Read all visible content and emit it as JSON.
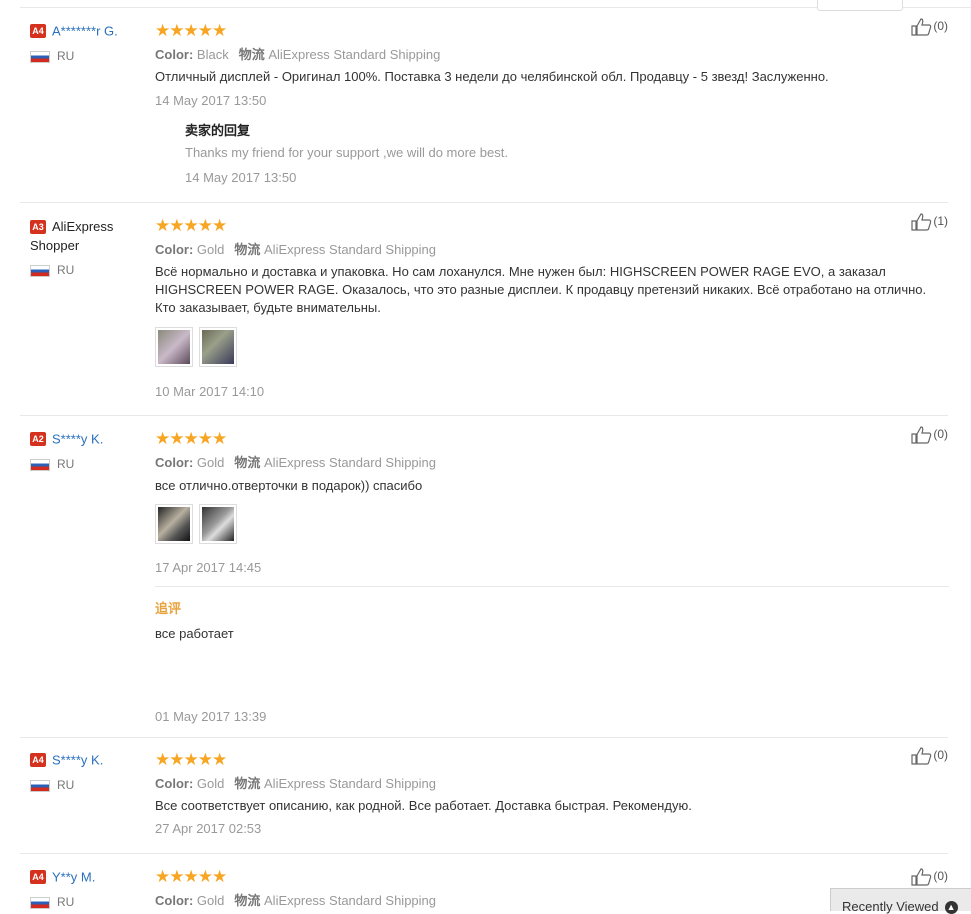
{
  "reviews": [
    {
      "level": "A4",
      "name": "A*******r G.",
      "country": "RU",
      "stars": "★★★★★",
      "color_label": "Color:",
      "color": "Black",
      "ship_label": "物流",
      "shipping": "AliExpress Standard Shipping",
      "text": "Отличный дисплей - Оригинал 100%. Поставка 3 недели до челябинской обл. Продавцу - 5 звезд! Заслуженно.",
      "date": "14 May 2017 13:50",
      "likes": "(0)",
      "reply": {
        "title": "卖家的回复",
        "text": "Thanks my friend for your support ,we will do more best.",
        "date": "14 May 2017 13:50"
      }
    },
    {
      "level": "A3",
      "name": "AliExpress Shopper",
      "country": "RU",
      "stars": "★★★★★",
      "color_label": "Color:",
      "color": "Gold",
      "ship_label": "物流",
      "shipping": "AliExpress Standard Shipping",
      "text": "Всё нормально и доставка и упаковка. Но сам лоханулся. Мне нужен был: HIGHSCREEN POWER RAGE EVO, а заказал HIGHSCREEN POWER RAGE. Оказалось, что это разные дисплеи. К продавцу претензий никаких. Всё отработано на отлично. Кто заказывает, будьте внимательны.",
      "date": "10 Mar 2017 14:10",
      "likes": "(1)"
    },
    {
      "level": "A2",
      "name": "S****y K.",
      "country": "RU",
      "stars": "★★★★★",
      "color_label": "Color:",
      "color": "Gold",
      "ship_label": "物流",
      "shipping": "AliExpress Standard Shipping",
      "text": "все отлично.отверточки в подарок)) спасибо",
      "date": "17 Apr 2017 14:45",
      "likes": "(0)",
      "followup": {
        "label": "追评",
        "text": "все работает",
        "date": "01 May 2017 13:39"
      }
    },
    {
      "level": "A4",
      "name": "S****y K.",
      "country": "RU",
      "stars": "★★★★★",
      "color_label": "Color:",
      "color": "Gold",
      "ship_label": "物流",
      "shipping": "AliExpress Standard Shipping",
      "text": "Все соответствует описанию, как родной. Все работает. Доставка быстрая. Рекомендую.",
      "date": "27 Apr 2017 02:53",
      "likes": "(0)"
    },
    {
      "level": "A4",
      "name": "Y**y M.",
      "country": "RU",
      "stars": "★★★★★",
      "color_label": "Color:",
      "color": "Gold",
      "ship_label": "物流",
      "shipping": "AliExpress Standard Shipping",
      "likes": "(0)"
    }
  ],
  "recently_viewed": "Recently Viewed",
  "colors": {
    "star": "#f6a623",
    "level_badge": "#d4321f",
    "user_link": "#2a6fbb",
    "followup": "#e8a33d"
  }
}
